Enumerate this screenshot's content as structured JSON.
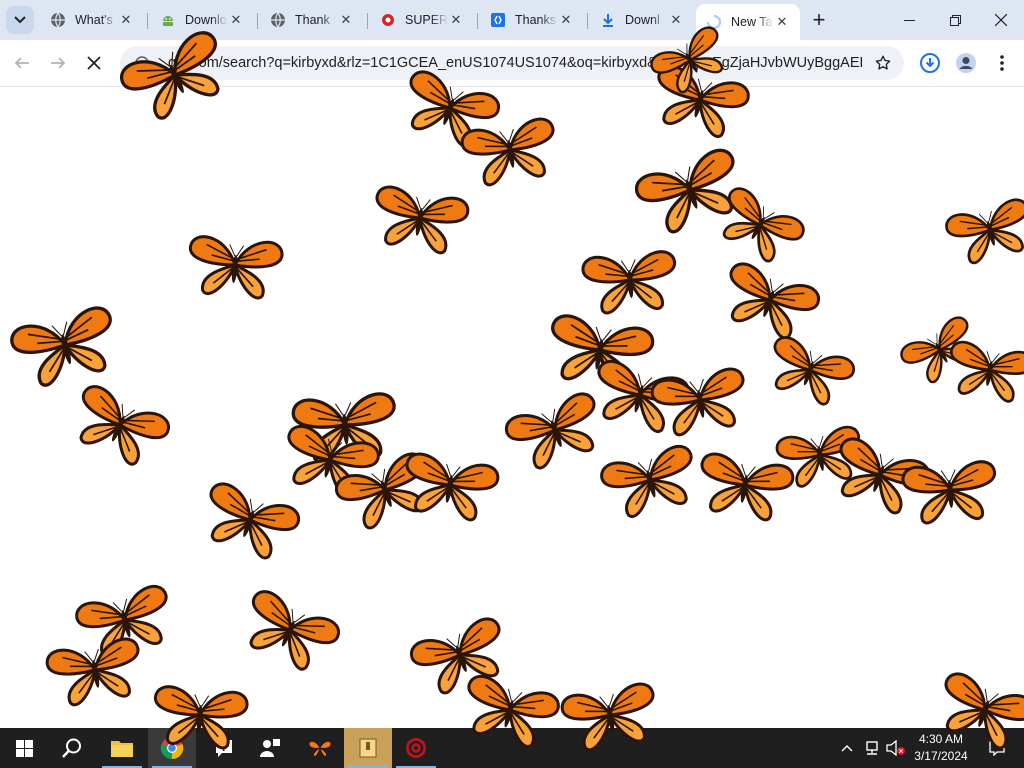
{
  "browser": {
    "tabs": [
      {
        "title": "What's",
        "favicon": "globe-icon",
        "active": false
      },
      {
        "title": "Downlo",
        "favicon": "android-icon",
        "active": false
      },
      {
        "title": "Thank",
        "favicon": "globe-icon",
        "active": false
      },
      {
        "title": "SUPER",
        "favicon": "red-logo-icon",
        "active": false
      },
      {
        "title": "Thanks",
        "favicon": "blue-bracket-icon",
        "active": false
      },
      {
        "title": "Downl",
        "favicon": "download-icon",
        "active": false
      },
      {
        "title": "New Ta",
        "favicon": "loading-spinner-icon",
        "active": true
      }
    ],
    "url": "gle.com/search?q=kirbyxd&rlz=1C1GCEA_enUS1074US1074&oq=kirbyxd&gs_lcrp=EgZjaHJvbWUyBggAEEU...",
    "accent": "#dee6f3"
  },
  "overlay": {
    "name": "monarch-butterflies",
    "colors": {
      "wing": "#f07a12",
      "wing_light": "#f9a23a",
      "vein": "#2a1508"
    }
  },
  "taskbar": {
    "clock_time": "4:30 AM",
    "clock_date": "3/17/2024",
    "background": "#1f1f1f"
  }
}
